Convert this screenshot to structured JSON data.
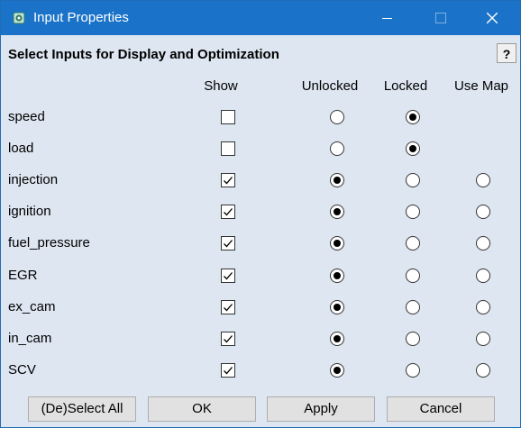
{
  "window": {
    "title": "Input Properties"
  },
  "heading": "Select Inputs for Display and Optimization",
  "help_label": "?",
  "columns": {
    "show": "Show",
    "unlocked": "Unlocked",
    "locked": "Locked",
    "use_map": "Use Map"
  },
  "rows": [
    {
      "name": "speed",
      "show": false,
      "mode": "locked",
      "has_map": false
    },
    {
      "name": "load",
      "show": false,
      "mode": "locked",
      "has_map": false
    },
    {
      "name": "injection",
      "show": true,
      "mode": "unlocked",
      "has_map": true
    },
    {
      "name": "ignition",
      "show": true,
      "mode": "unlocked",
      "has_map": true
    },
    {
      "name": "fuel_pressure",
      "show": true,
      "mode": "unlocked",
      "has_map": true
    },
    {
      "name": "EGR",
      "show": true,
      "mode": "unlocked",
      "has_map": true
    },
    {
      "name": "ex_cam",
      "show": true,
      "mode": "unlocked",
      "has_map": true
    },
    {
      "name": "in_cam",
      "show": true,
      "mode": "unlocked",
      "has_map": true
    },
    {
      "name": "SCV",
      "show": true,
      "mode": "unlocked",
      "has_map": true
    }
  ],
  "buttons": {
    "select_all": "(De)Select All",
    "ok": "OK",
    "apply": "Apply",
    "cancel": "Cancel"
  },
  "icons": {
    "app": "app-icon",
    "minimize": "minimize-icon",
    "maximize": "maximize-icon",
    "close": "close-icon"
  },
  "colors": {
    "titlebar": "#1a73c8",
    "background": "#dde6f1"
  }
}
